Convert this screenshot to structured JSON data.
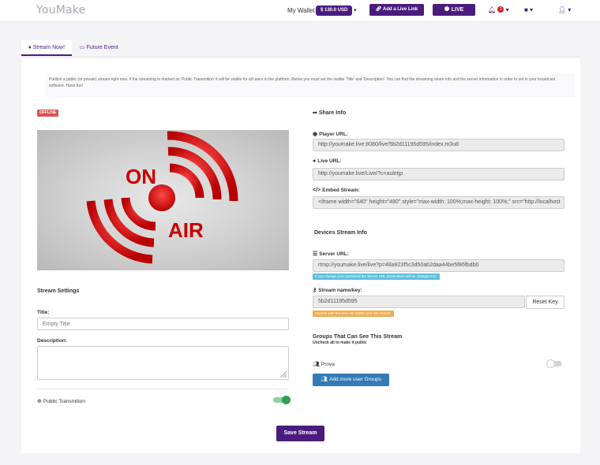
{
  "navbar": {
    "logo": "YouMake",
    "wallet_label": "My Wallet",
    "wallet_amount": "$ 130.0 USD",
    "add_live_link": "Add a Live Link",
    "live_button": "LIVE",
    "notification_count": "1"
  },
  "tabs": [
    {
      "label": "Stream Now!",
      "icon": "broadcast-icon",
      "active": true
    },
    {
      "label": "Future Event",
      "icon": "calendar-icon",
      "active": false
    }
  ],
  "notice": "Publish a public (or private) stream right now.  If the streaming is marked as 'Public Transmition' it will be visible for all users in the platform. Below you must set the visible 'Title' and 'Description'. You can find the streaming share info and the server information in order to set in your broadcast software. Have fun!",
  "preview": {
    "status_badge": "OFFLINE",
    "image_text_top": "ON",
    "image_text_bottom": "AIR"
  },
  "stream_settings": {
    "heading": "Stream Settings",
    "title_label": "Title:",
    "title_placeholder": "Empty Title",
    "title_value": "",
    "description_label": "Description:",
    "description_value": "",
    "public_label": "Public Transmition",
    "public_enabled": true
  },
  "share_info": {
    "heading": "Share Info",
    "player_url_label": "Player URL:",
    "player_url": "http://youmake.live:8080/live/5b2d11195d595/index.m3u8",
    "live_url_label": "Live URL:",
    "live_url": "http://youmake.live/Live/?c=auletjp",
    "embed_label": "Embed Stream:",
    "embed_code": "<iframe width=\"640\" height=\"480\" style=\"max-width: 100%;max-height: 100%;\" src=\"http://localhost"
  },
  "devices": {
    "heading": "Devices Stream Info",
    "server_url_label": "Server URL:",
    "server_url": "rtmp://youmake.live/live?p=48a823f5c3d50ab2daa44be5f86fbdb0",
    "server_hint": "If you change your password the Server URL parameters will be changed too.",
    "key_label": "Stream name/key:",
    "key_value": "5b2d11195d595",
    "reset_key": "Reset Key",
    "key_hint": "Anyone with this key can watch your live stream."
  },
  "groups": {
    "heading": "Groups That Can See This Stream",
    "subheading": "Uncheck all to make it public",
    "items": [
      {
        "name": "Prova",
        "enabled": false
      }
    ],
    "add_button": "Add more user Groups"
  },
  "save_button": "Save Stream",
  "colors": {
    "brand": "#4a1c7c",
    "danger": "#d9534f",
    "info": "#5bc0de",
    "warning": "#f0ad4e",
    "primary": "#337ab7",
    "success": "#2e9e4f"
  }
}
